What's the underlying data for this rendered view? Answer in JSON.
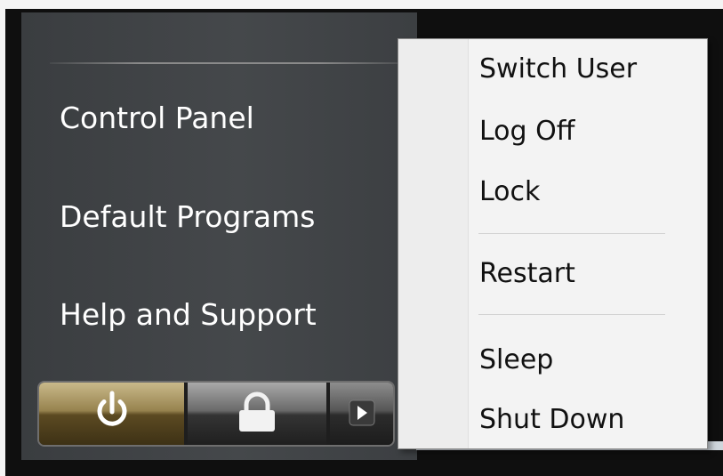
{
  "start_menu": {
    "links": [
      {
        "label": "Control Panel"
      },
      {
        "label": "Default Programs"
      },
      {
        "label": "Help and Support"
      }
    ],
    "buttons": {
      "power_icon": "power-icon",
      "lock_icon": "lock-icon",
      "arrow_icon": "arrow-right-icon"
    }
  },
  "shutdown_menu": {
    "items": [
      {
        "label": "Switch User"
      },
      {
        "label": "Log Off"
      },
      {
        "label": "Lock"
      },
      {
        "label": "Restart"
      },
      {
        "label": "Sleep"
      },
      {
        "label": "Shut Down"
      }
    ]
  },
  "colors": {
    "panel": "#3f4245",
    "menu_background": "#f3f3f3",
    "power_button": "#97834f"
  }
}
